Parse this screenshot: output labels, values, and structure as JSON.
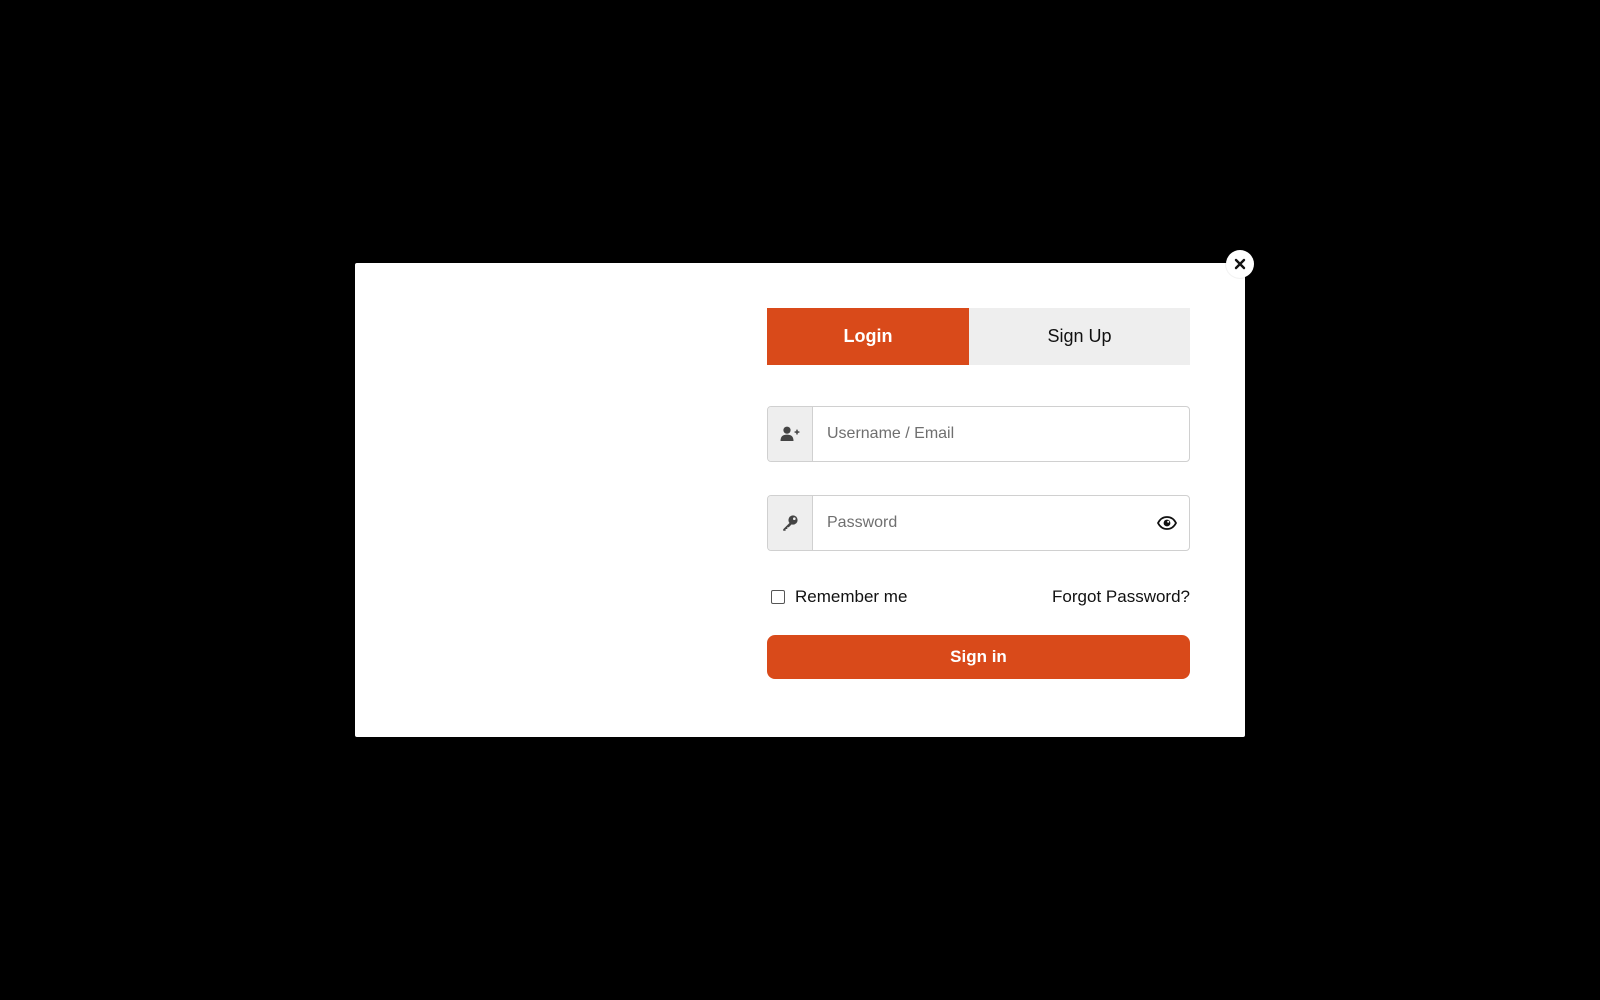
{
  "modal": {
    "close_icon": "close-icon",
    "tabs": [
      {
        "label": "Login",
        "active": true
      },
      {
        "label": "Sign Up",
        "active": false
      }
    ],
    "username": {
      "icon": "user-plus-icon",
      "placeholder": "Username / Email",
      "value": ""
    },
    "password": {
      "icon": "key-icon",
      "placeholder": "Password",
      "value": "",
      "toggle_icon": "eye-icon"
    },
    "remember": {
      "label": "Remember me",
      "checked": false
    },
    "forgot_label": "Forgot Password?",
    "submit_label": "Sign in"
  },
  "colors": {
    "accent": "#d94a1a",
    "tab_inactive_bg": "#eeeeee",
    "backdrop": "#000000",
    "modal_bg": "#ffffff"
  }
}
